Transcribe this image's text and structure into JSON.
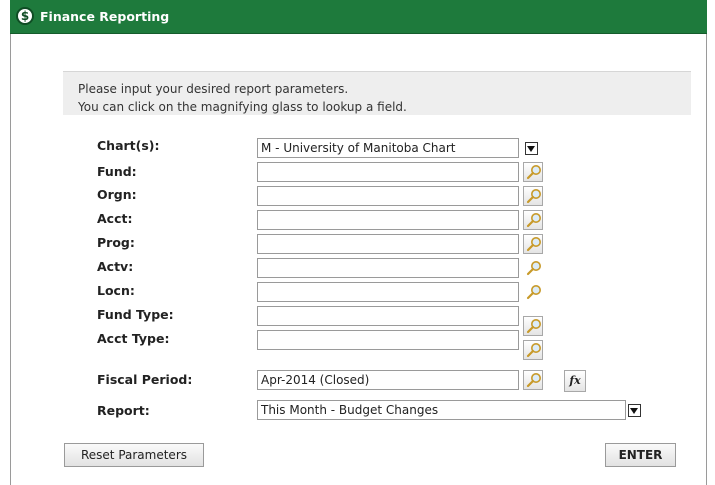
{
  "header": {
    "title": "Finance Reporting",
    "logo_glyph": "$"
  },
  "instructions": {
    "line1": "Please input your desired report parameters.",
    "line2": "You can click on the magnifying glass to lookup a field."
  },
  "form": {
    "chart": {
      "label": "Chart(s):",
      "value": "M - University of Manitoba Chart"
    },
    "fund": {
      "label": "Fund:",
      "value": ""
    },
    "orgn": {
      "label": "Orgn:",
      "value": ""
    },
    "acct": {
      "label": "Acct:",
      "value": ""
    },
    "prog": {
      "label": "Prog:",
      "value": ""
    },
    "actv": {
      "label": "Actv:",
      "value": ""
    },
    "locn": {
      "label": "Locn:",
      "value": ""
    },
    "fund_type": {
      "label": "Fund Type:",
      "value": ""
    },
    "acct_type": {
      "label": "Acct Type:",
      "value": ""
    },
    "fiscal_period": {
      "label": "Fiscal Period:",
      "value": "Apr-2014 (Closed)"
    },
    "report": {
      "label": "Report:",
      "value": "This Month - Budget Changes"
    }
  },
  "buttons": {
    "reset": "Reset Parameters",
    "enter": "ENTER",
    "fx": "fx"
  },
  "icons": {
    "lookup": "magnifying-glass-icon",
    "dropdown": "dropdown-arrow-icon",
    "function": "function-icon"
  },
  "colors": {
    "header_bg": "#1e7a3c",
    "info_bg": "#eeeeee"
  }
}
